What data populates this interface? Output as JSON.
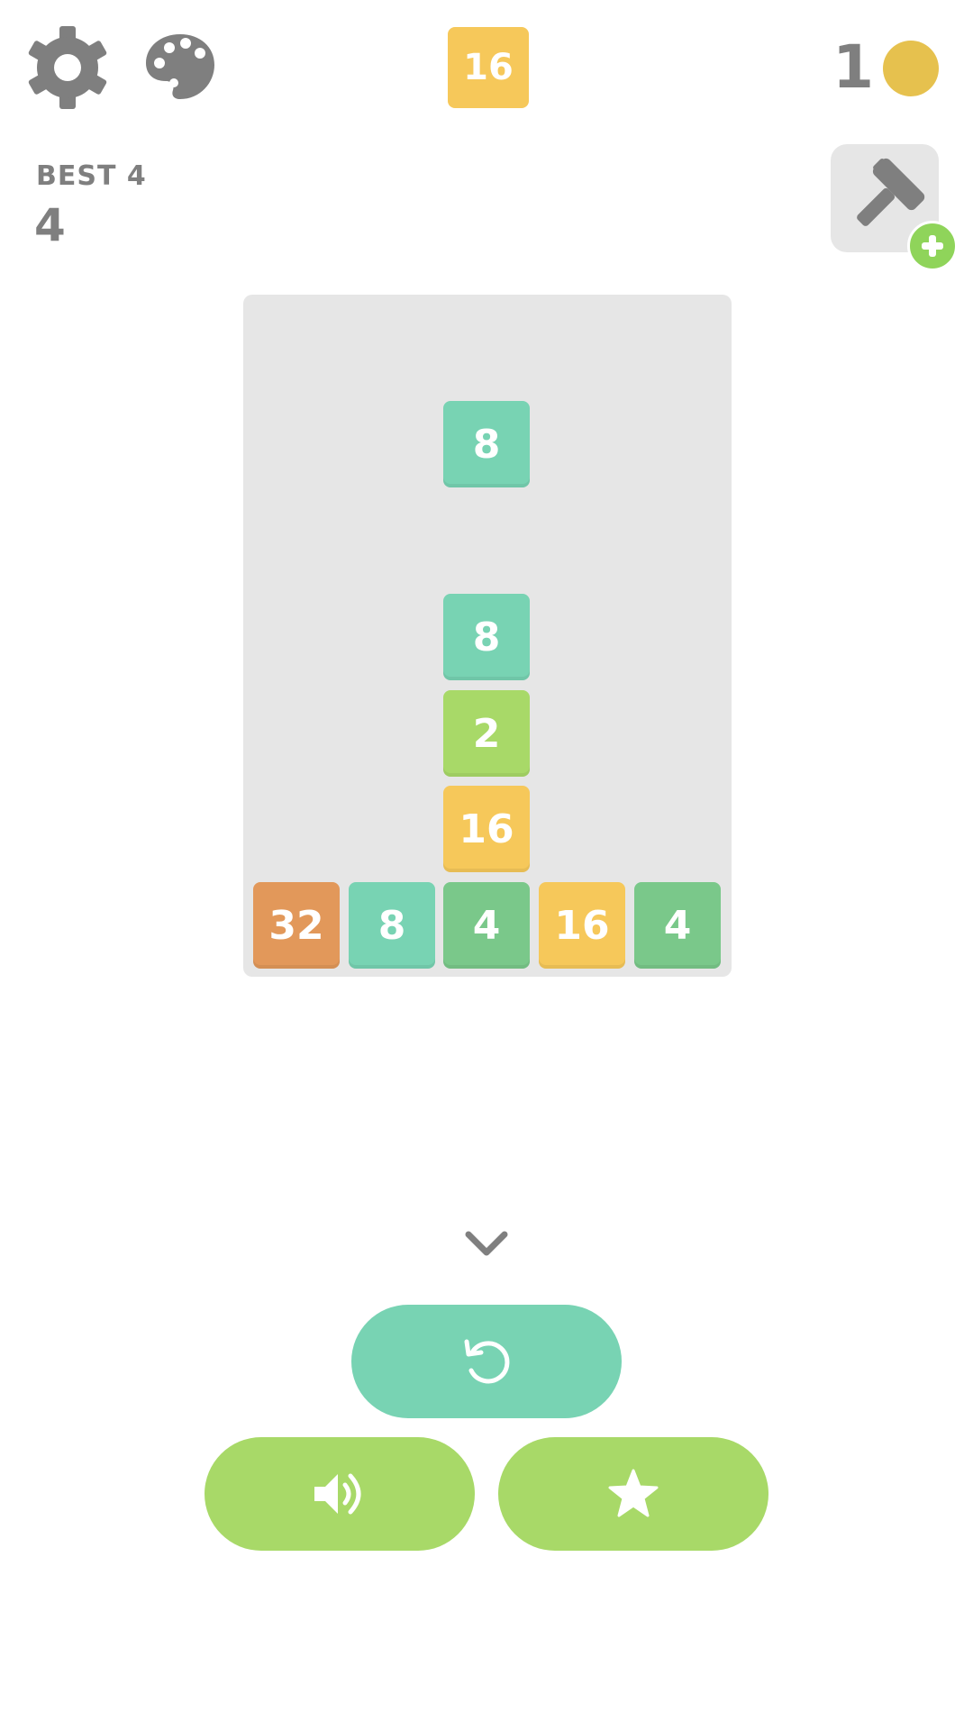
{
  "colors": {
    "icon_gray": "#7f7f7f",
    "board_bg": "#e6e6e6",
    "coin": "#e6c14e",
    "teal": "#78d3b3",
    "light_green": "#a8d968",
    "green": "#7ac88a",
    "yellow": "#f6c85a",
    "orange": "#e2985a",
    "badge_green": "#8fd45a"
  },
  "top_bar": {
    "settings_icon": "gear-icon",
    "palette_icon": "palette-icon",
    "next_tile": {
      "value": "16",
      "color": "#f6c85a"
    },
    "coin_count": "1",
    "coin_icon": "coin-icon"
  },
  "stats": {
    "best_label": "BEST 4",
    "score": "4"
  },
  "powerup": {
    "hammer_icon": "hammer-icon",
    "plus_icon": "plus-icon"
  },
  "board": {
    "falling_tile": {
      "value": "8",
      "color": "#78d3b3"
    },
    "column_stack": [
      {
        "value": "8",
        "color": "#78d3b3"
      },
      {
        "value": "2",
        "color": "#a8d968"
      },
      {
        "value": "16",
        "color": "#f6c85a"
      }
    ],
    "bottom_row": [
      {
        "value": "32",
        "color": "#e2985a"
      },
      {
        "value": "8",
        "color": "#78d3b3"
      },
      {
        "value": "4",
        "color": "#7ac88a"
      },
      {
        "value": "16",
        "color": "#f6c85a"
      },
      {
        "value": "4",
        "color": "#7ac88a"
      }
    ]
  },
  "controls": {
    "collapse_icon": "chevron-down-icon",
    "restart_icon": "restart-icon",
    "sound_icon": "speaker-icon",
    "rate_icon": "star-icon"
  }
}
